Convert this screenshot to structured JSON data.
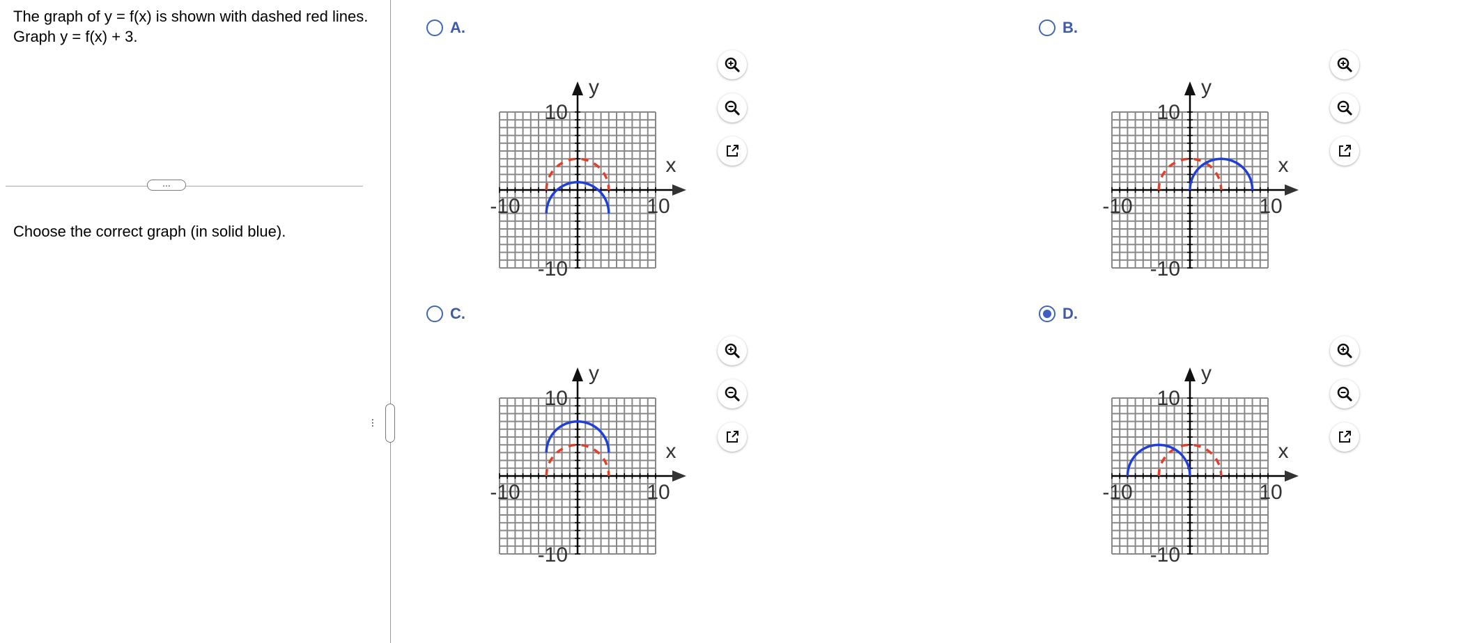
{
  "question": {
    "text": "The graph of y = f(x) is shown with dashed  red lines. Graph y = f(x) + 3.",
    "instruction": "Choose the correct graph (in solid blue).",
    "divider_button": "...",
    "splitter_handle": "..."
  },
  "choices": [
    {
      "label": "A.",
      "selected": false,
      "graph": {
        "x_label": "x",
        "y_label": "y",
        "tick_pos": "10",
        "tick_neg": "-10"
      }
    },
    {
      "label": "B.",
      "selected": false,
      "graph": {
        "x_label": "x",
        "y_label": "y",
        "tick_pos": "10",
        "tick_neg": "-10"
      }
    },
    {
      "label": "C.",
      "selected": false,
      "graph": {
        "x_label": "x",
        "y_label": "y",
        "tick_pos": "10",
        "tick_neg": "-10"
      }
    },
    {
      "label": "D.",
      "selected": true,
      "graph": {
        "x_label": "x",
        "y_label": "y",
        "tick_pos": "10",
        "tick_neg": "-10"
      }
    }
  ],
  "chart_data": [
    {
      "type": "line",
      "xlim": [
        -10,
        10
      ],
      "ylim": [
        -10,
        10
      ],
      "grid": true,
      "series": [
        {
          "style": "dashed",
          "color": "#e0402a",
          "shape": "semicircle",
          "center": [
            0,
            0
          ],
          "radius": 4
        },
        {
          "style": "solid",
          "color": "#1f3fd6",
          "shape": "semicircle",
          "center": [
            0,
            -3
          ],
          "radius": 4
        }
      ]
    },
    {
      "type": "line",
      "xlim": [
        -10,
        10
      ],
      "ylim": [
        -10,
        10
      ],
      "grid": true,
      "series": [
        {
          "style": "dashed",
          "color": "#e0402a",
          "shape": "semicircle",
          "center": [
            0,
            0
          ],
          "radius": 4
        },
        {
          "style": "solid",
          "color": "#1f3fd6",
          "shape": "semicircle",
          "center": [
            4,
            0
          ],
          "radius": 4
        }
      ]
    },
    {
      "type": "line",
      "xlim": [
        -10,
        10
      ],
      "ylim": [
        -10,
        10
      ],
      "grid": true,
      "series": [
        {
          "style": "dashed",
          "color": "#e0402a",
          "shape": "semicircle",
          "center": [
            0,
            0
          ],
          "radius": 4
        },
        {
          "style": "solid",
          "color": "#1f3fd6",
          "shape": "semicircle",
          "center": [
            0,
            3
          ],
          "radius": 4
        }
      ]
    },
    {
      "type": "line",
      "xlim": [
        -10,
        10
      ],
      "ylim": [
        -10,
        10
      ],
      "grid": true,
      "series": [
        {
          "style": "dashed",
          "color": "#e0402a",
          "shape": "semicircle",
          "center": [
            0,
            0
          ],
          "radius": 4
        },
        {
          "style": "solid",
          "color": "#1f3fd6",
          "shape": "semicircle",
          "center": [
            -4,
            0
          ],
          "radius": 4
        }
      ]
    }
  ],
  "tools": [
    {
      "icon": "zoom-in-icon"
    },
    {
      "icon": "zoom-out-icon"
    },
    {
      "icon": "open-new-window-icon"
    }
  ]
}
